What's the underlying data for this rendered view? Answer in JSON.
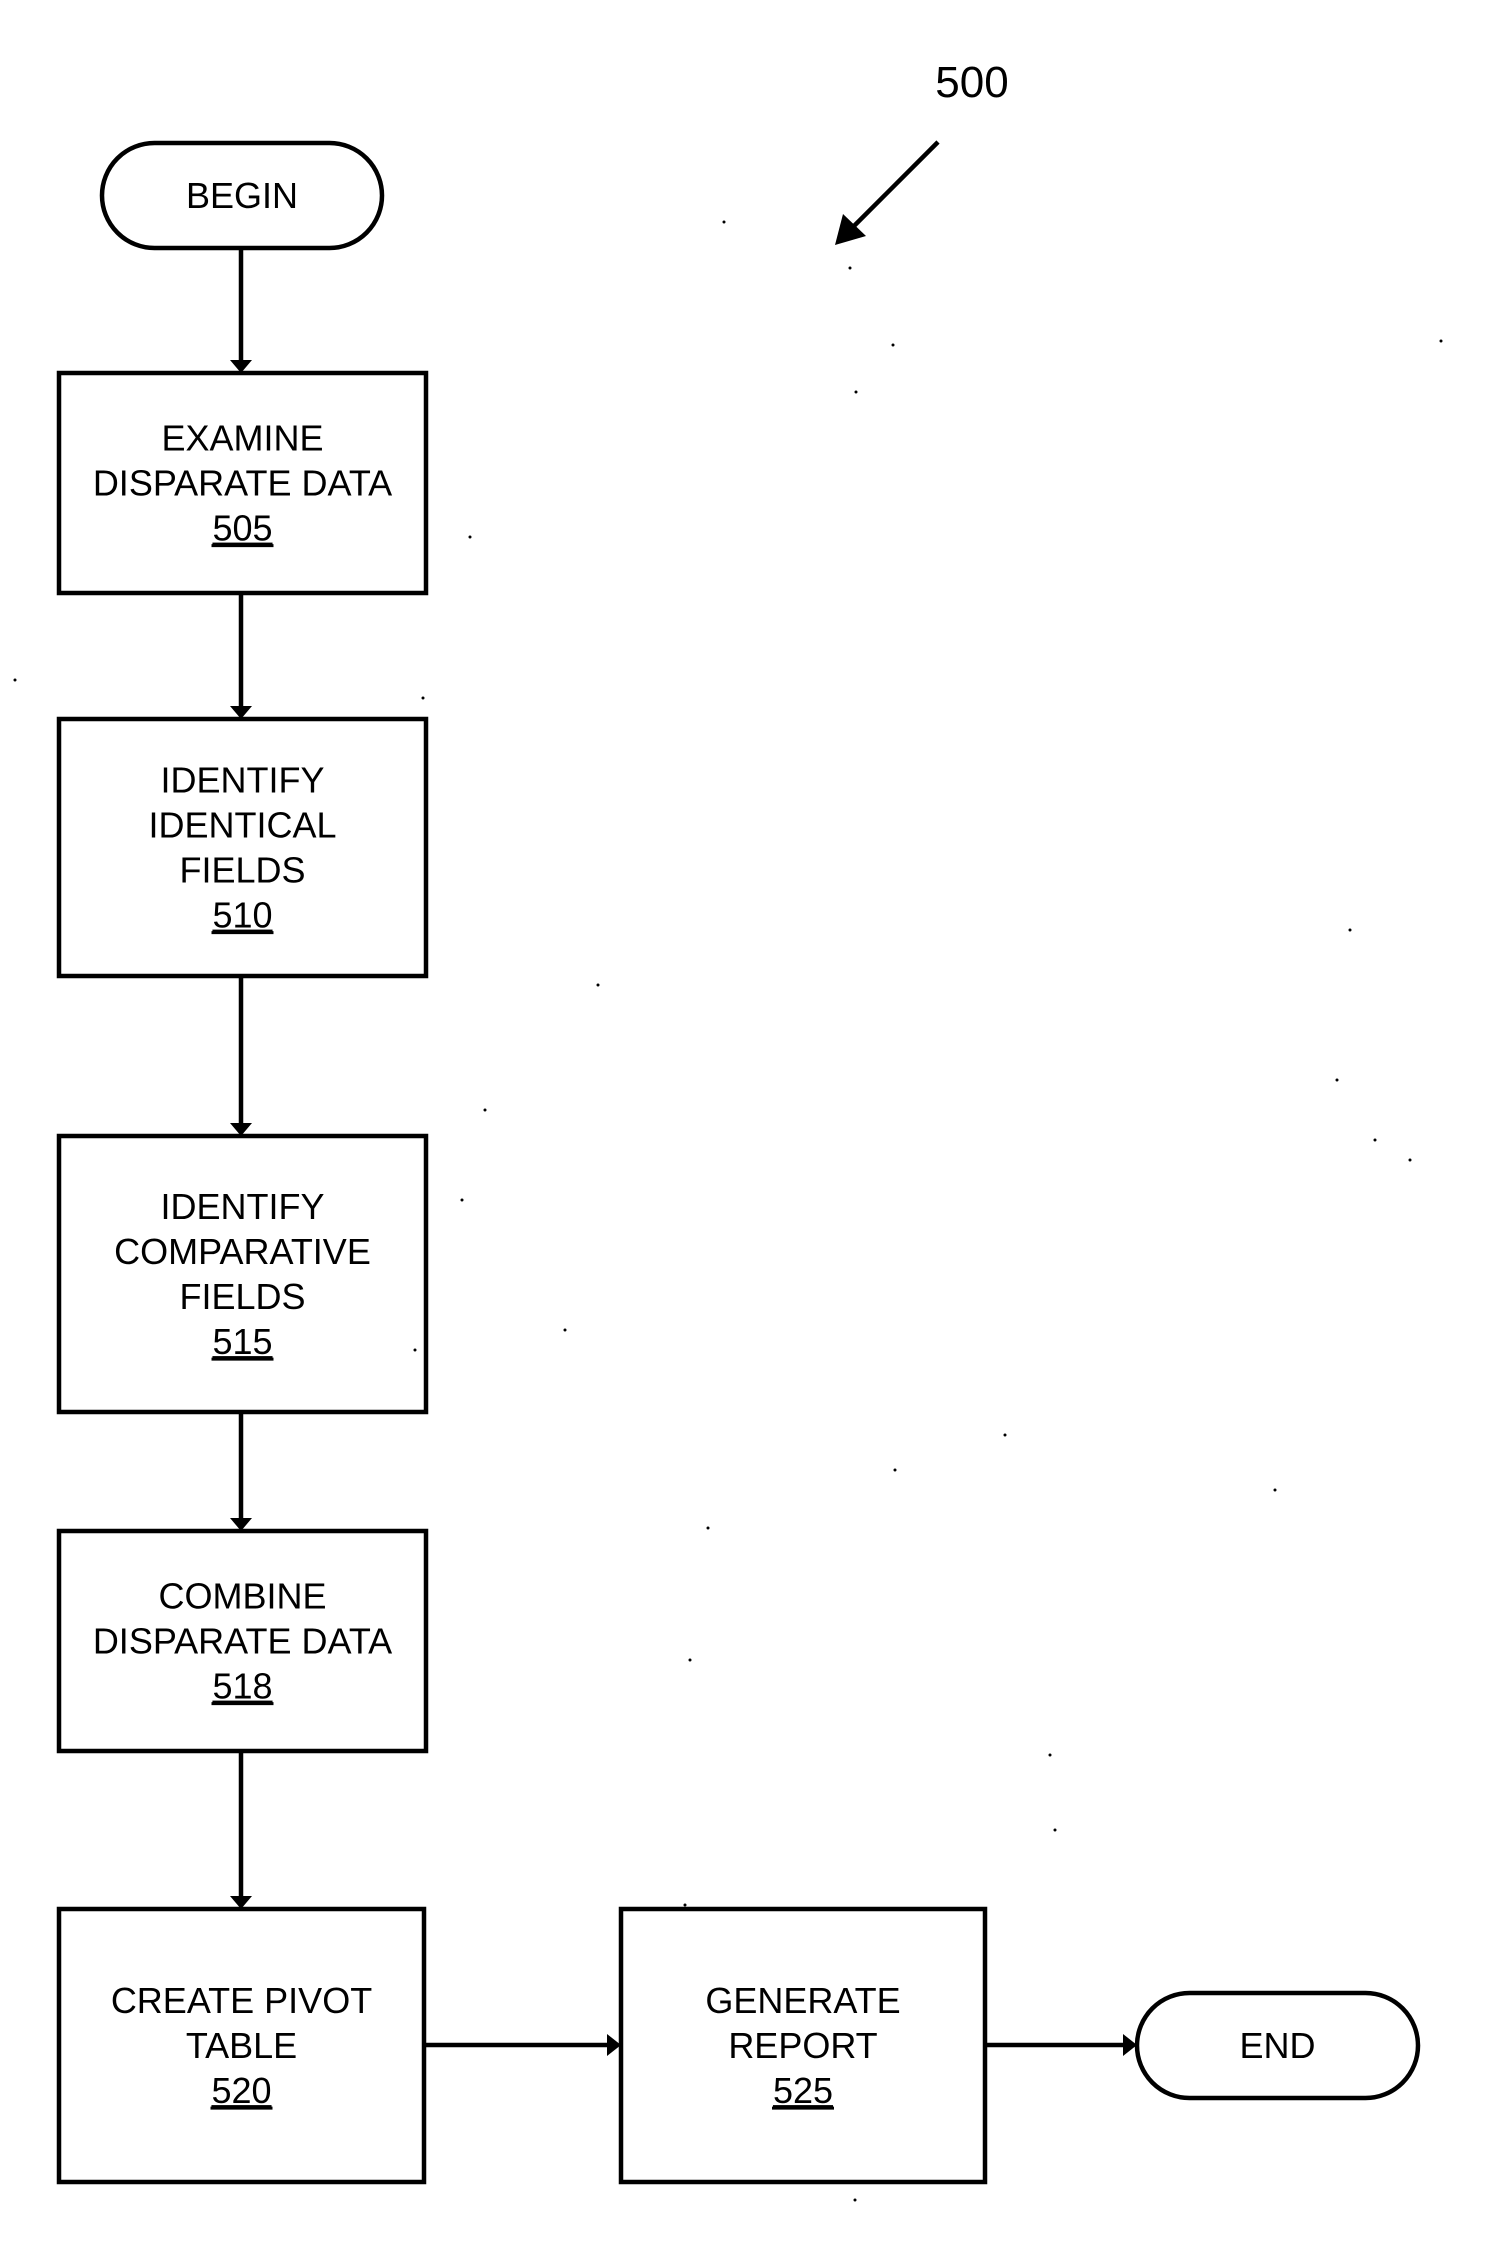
{
  "figure": {
    "label": "500",
    "description": "Flowchart of a method for combining disparate data into a pivot table and generating a report"
  },
  "nodes": [
    {
      "id": "begin",
      "type": "terminator",
      "lines": [
        "BEGIN"
      ],
      "ref": ""
    },
    {
      "id": "505",
      "type": "process",
      "lines": [
        "EXAMINE",
        "DISPARATE DATA"
      ],
      "ref": "505"
    },
    {
      "id": "510",
      "type": "process",
      "lines": [
        "IDENTIFY",
        "IDENTICAL",
        "FIELDS"
      ],
      "ref": "510"
    },
    {
      "id": "515",
      "type": "process",
      "lines": [
        "IDENTIFY",
        "COMPARATIVE",
        "FIELDS"
      ],
      "ref": "515"
    },
    {
      "id": "518",
      "type": "process",
      "lines": [
        "COMBINE",
        "DISPARATE DATA"
      ],
      "ref": "518"
    },
    {
      "id": "520",
      "type": "process",
      "lines": [
        "CREATE PIVOT",
        "TABLE"
      ],
      "ref": "520"
    },
    {
      "id": "525",
      "type": "process",
      "lines": [
        "GENERATE",
        "REPORT"
      ],
      "ref": "525"
    },
    {
      "id": "end",
      "type": "terminator",
      "lines": [
        "END"
      ],
      "ref": ""
    }
  ],
  "edges": [
    {
      "from": "begin",
      "to": "505"
    },
    {
      "from": "505",
      "to": "510"
    },
    {
      "from": "510",
      "to": "515"
    },
    {
      "from": "515",
      "to": "518"
    },
    {
      "from": "518",
      "to": "520"
    },
    {
      "from": "520",
      "to": "525"
    },
    {
      "from": "525",
      "to": "end"
    }
  ]
}
